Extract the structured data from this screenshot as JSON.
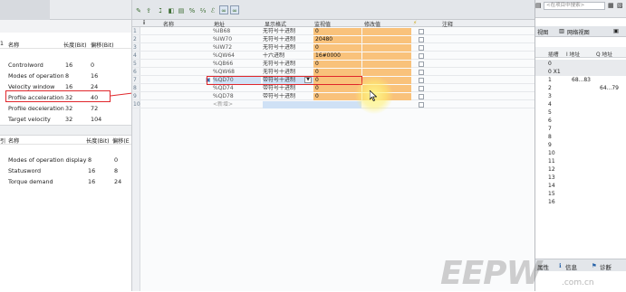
{
  "left_panel": {
    "table1": {
      "header": {
        "name": "名称",
        "length": "长度(Bit)",
        "offset": "偏移(Bit)",
        "index_fragment": "1"
      },
      "rows": [
        {
          "name": "Controlword",
          "length": "16",
          "offset": "0"
        },
        {
          "name": "Modes of operation",
          "length": "8",
          "offset": "16"
        },
        {
          "name": "Velocity window",
          "length": "16",
          "offset": "24"
        },
        {
          "name": "Profile acceleration",
          "length": "32",
          "offset": "40"
        },
        {
          "name": "Profile deceleration",
          "length": "32",
          "offset": "72"
        },
        {
          "name": "Target velocity",
          "length": "32",
          "offset": "104"
        }
      ]
    },
    "table2": {
      "header": {
        "index_fragment": "引",
        "name": "名称",
        "length": "长度(Bit)",
        "offset": "偏移(E"
      },
      "rows": [
        {
          "name": "Modes of operation display",
          "length": "8",
          "offset": "0"
        },
        {
          "name": "Statusword",
          "length": "16",
          "offset": "8"
        },
        {
          "name": "Torque demand",
          "length": "16",
          "offset": "24"
        }
      ]
    }
  },
  "editor": {
    "columns": {
      "index": "i",
      "name": "名称",
      "address": "地址",
      "display_format": "显示格式",
      "monitor_value": "监视值",
      "modify_value": "修改值",
      "comment": "注释"
    },
    "rows": [
      {
        "no": "1",
        "address": "%IB68",
        "format": "无符号十进制",
        "monitor": "0"
      },
      {
        "no": "2",
        "address": "%IW70",
        "format": "无符号十进制",
        "monitor": "20480"
      },
      {
        "no": "3",
        "address": "%IW72",
        "format": "无符号十进制",
        "monitor": "0"
      },
      {
        "no": "4",
        "address": "%QW64",
        "format": "十六进制",
        "monitor": "16#0000"
      },
      {
        "no": "5",
        "address": "%QB66",
        "format": "无符号十进制",
        "monitor": "0"
      },
      {
        "no": "6",
        "address": "%QW68",
        "format": "无符号十进制",
        "monitor": "0"
      },
      {
        "no": "7",
        "address": "%QD70",
        "format": "带符号十进制",
        "monitor": "0"
      },
      {
        "no": "8",
        "address": "%QD74",
        "format": "带符号十进制",
        "monitor": "0"
      },
      {
        "no": "9",
        "address": "%QD78",
        "format": "带符号十进制",
        "monitor": "0"
      },
      {
        "no": "10",
        "address": "<新增>",
        "format": "",
        "monitor": ""
      }
    ]
  },
  "right_panel": {
    "search_placeholder": "<在项目中搜索>",
    "tabs": {
      "topology": "视图",
      "network": "网络视图"
    },
    "table_header": {
      "slot": "插槽",
      "i_address": "I 地址",
      "q_address": "Q 地址"
    },
    "rows": [
      {
        "slot": "0",
        "i": "",
        "q": ""
      },
      {
        "slot": "0 X1",
        "i": "",
        "q": ""
      },
      {
        "slot": "1",
        "i": "68...83",
        "q": ""
      },
      {
        "slot": "2",
        "i": "",
        "q": "64...79"
      },
      {
        "slot": "3",
        "i": "",
        "q": ""
      },
      {
        "slot": "4",
        "i": "",
        "q": ""
      },
      {
        "slot": "5",
        "i": "",
        "q": ""
      },
      {
        "slot": "6",
        "i": "",
        "q": ""
      },
      {
        "slot": "7",
        "i": "",
        "q": ""
      },
      {
        "slot": "8",
        "i": "",
        "q": ""
      },
      {
        "slot": "9",
        "i": "",
        "q": ""
      },
      {
        "slot": "10",
        "i": "",
        "q": ""
      },
      {
        "slot": "11",
        "i": "",
        "q": ""
      },
      {
        "slot": "12",
        "i": "",
        "q": ""
      },
      {
        "slot": "13",
        "i": "",
        "q": ""
      },
      {
        "slot": "14",
        "i": "",
        "q": ""
      },
      {
        "slot": "15",
        "i": "",
        "q": ""
      },
      {
        "slot": "16",
        "i": "",
        "q": ""
      }
    ],
    "bottom_tabs": {
      "properties": "属性",
      "info": "信息",
      "diagnostics": "诊断"
    }
  },
  "watermark": {
    "text": "EEPW",
    "sub": ".com.cn"
  },
  "colors": {
    "highlight_red": "#e0262b",
    "monitor_orange": "#f9c27b",
    "selection_blue": "#cfe1f5"
  }
}
